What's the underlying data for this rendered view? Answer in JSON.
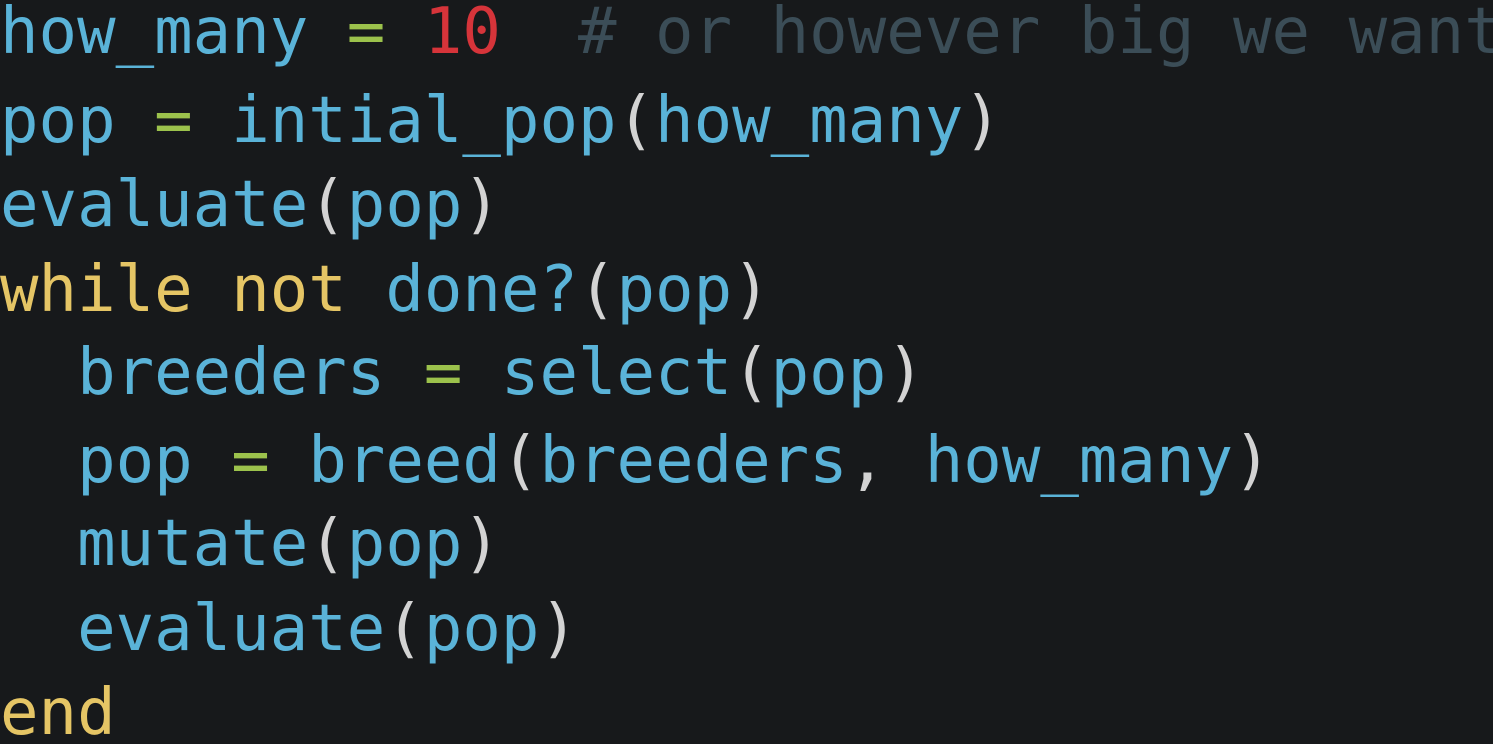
{
  "code_editor": {
    "colors": {
      "background": "#17191b",
      "identifier": "#5ab3d8",
      "operator": "#9cc24c",
      "number": "#d6343a",
      "comment": "#3b4d57",
      "keyword": "#e5c565",
      "punctuation": "#d3d3d3"
    },
    "lines": [
      {
        "indent": "",
        "tokens": [
          {
            "type": "ident",
            "text": "how_many"
          },
          {
            "type": "ws",
            "text": " "
          },
          {
            "type": "op",
            "text": "="
          },
          {
            "type": "ws",
            "text": " "
          },
          {
            "type": "num",
            "text": "10"
          },
          {
            "type": "ws",
            "text": "  "
          },
          {
            "type": "comment",
            "text": "# or however big we want"
          }
        ]
      },
      {
        "indent": "",
        "tokens": [
          {
            "type": "ident",
            "text": "pop"
          },
          {
            "type": "ws",
            "text": " "
          },
          {
            "type": "op",
            "text": "="
          },
          {
            "type": "ws",
            "text": " "
          },
          {
            "type": "ident",
            "text": "intial_pop"
          },
          {
            "type": "punct",
            "text": "("
          },
          {
            "type": "ident",
            "text": "how_many"
          },
          {
            "type": "punct",
            "text": ")"
          }
        ]
      },
      {
        "indent": "",
        "tokens": [
          {
            "type": "ident",
            "text": "evaluate"
          },
          {
            "type": "punct",
            "text": "("
          },
          {
            "type": "ident",
            "text": "pop"
          },
          {
            "type": "punct",
            "text": ")"
          }
        ]
      },
      {
        "indent": "",
        "tokens": [
          {
            "type": "kw",
            "text": "while"
          },
          {
            "type": "ws",
            "text": " "
          },
          {
            "type": "kw",
            "text": "not"
          },
          {
            "type": "ws",
            "text": " "
          },
          {
            "type": "ident",
            "text": "done?"
          },
          {
            "type": "punct",
            "text": "("
          },
          {
            "type": "ident",
            "text": "pop"
          },
          {
            "type": "punct",
            "text": ")"
          }
        ]
      },
      {
        "indent": "  ",
        "tokens": [
          {
            "type": "ident",
            "text": "breeders"
          },
          {
            "type": "ws",
            "text": " "
          },
          {
            "type": "op",
            "text": "="
          },
          {
            "type": "ws",
            "text": " "
          },
          {
            "type": "ident",
            "text": "select"
          },
          {
            "type": "punct",
            "text": "("
          },
          {
            "type": "ident",
            "text": "pop"
          },
          {
            "type": "punct",
            "text": ")"
          }
        ]
      },
      {
        "indent": "  ",
        "tokens": [
          {
            "type": "ident",
            "text": "pop"
          },
          {
            "type": "ws",
            "text": " "
          },
          {
            "type": "op",
            "text": "="
          },
          {
            "type": "ws",
            "text": " "
          },
          {
            "type": "ident",
            "text": "breed"
          },
          {
            "type": "punct",
            "text": "("
          },
          {
            "type": "ident",
            "text": "breeders"
          },
          {
            "type": "punct",
            "text": ","
          },
          {
            "type": "ws",
            "text": " "
          },
          {
            "type": "ident",
            "text": "how_many"
          },
          {
            "type": "punct",
            "text": ")"
          }
        ]
      },
      {
        "indent": "  ",
        "tokens": [
          {
            "type": "ident",
            "text": "mutate"
          },
          {
            "type": "punct",
            "text": "("
          },
          {
            "type": "ident",
            "text": "pop"
          },
          {
            "type": "punct",
            "text": ")"
          }
        ]
      },
      {
        "indent": "  ",
        "tokens": [
          {
            "type": "ident",
            "text": "evaluate"
          },
          {
            "type": "punct",
            "text": "("
          },
          {
            "type": "ident",
            "text": "pop"
          },
          {
            "type": "punct",
            "text": ")"
          }
        ]
      },
      {
        "indent": "",
        "tokens": [
          {
            "type": "kw",
            "text": "end"
          }
        ]
      }
    ]
  }
}
